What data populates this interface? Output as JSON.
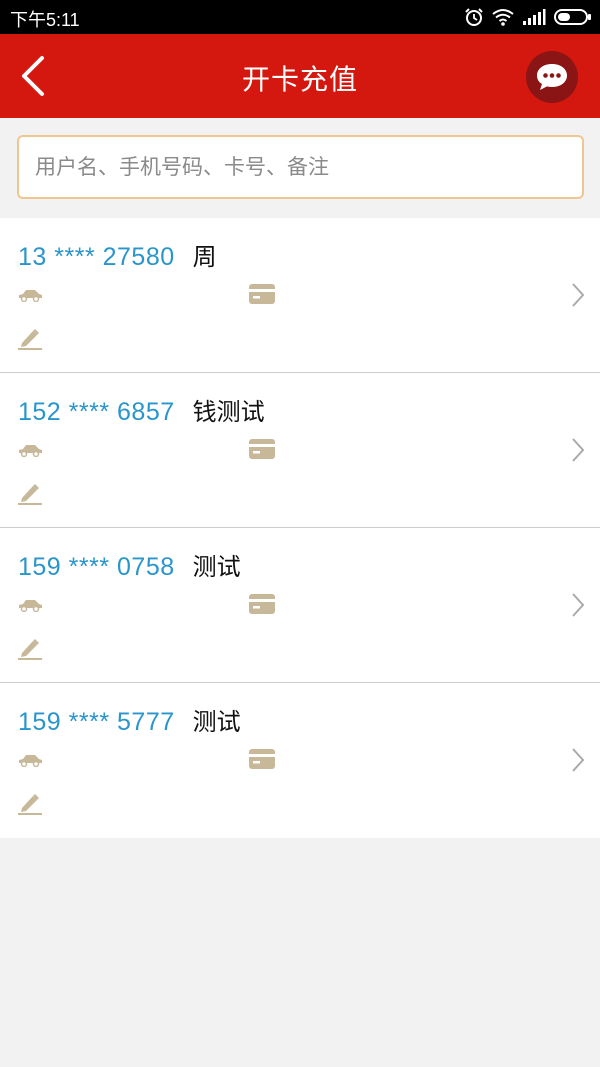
{
  "status_bar": {
    "time": "下午5:11"
  },
  "header": {
    "title": "开卡充值"
  },
  "search": {
    "placeholder": "用户名、手机号码、卡号、备注"
  },
  "customers": [
    {
      "phone": "13 **** 27580",
      "name": "周"
    },
    {
      "phone": "152 **** 6857",
      "name": "钱测试"
    },
    {
      "phone": "159 **** 0758",
      "name": "测试"
    },
    {
      "phone": "159 **** 5777",
      "name": "测试"
    }
  ],
  "colors": {
    "header": "#d4180f",
    "phone": "#2a95cc",
    "icon": "#c8b89a",
    "search_border": "#f0c690"
  },
  "icons": {
    "back": "chevron-left-icon",
    "message": "chat-bubble-icon",
    "car": "car-icon",
    "card": "card-icon",
    "edit": "pencil-icon",
    "chevron": "chevron-right-icon"
  }
}
